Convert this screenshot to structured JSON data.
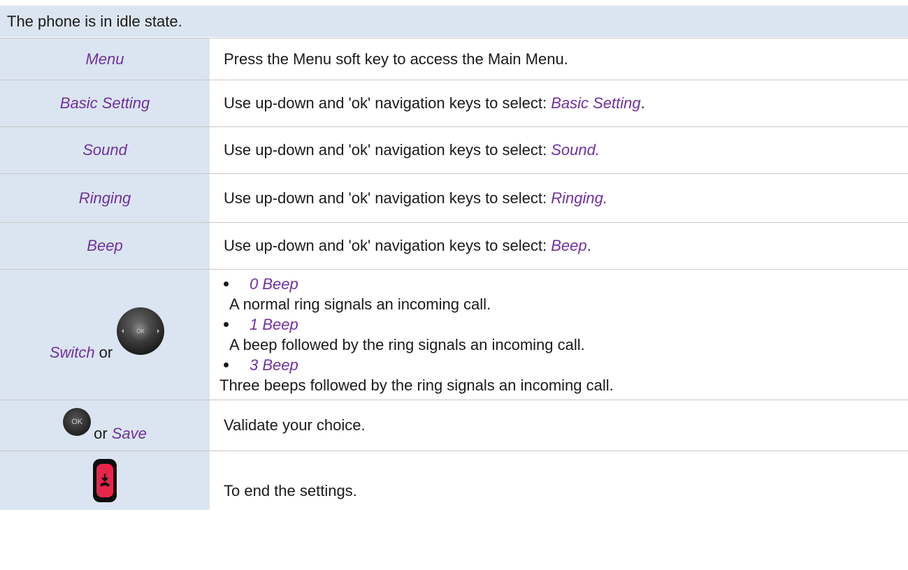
{
  "intro": "The phone is in idle state.",
  "rows": [
    {
      "key": "Menu",
      "desc": "Press the Menu soft key to access the Main Menu."
    },
    {
      "key": "Basic Setting",
      "desc_prefix": "Use up-down and 'ok' navigation keys to select: ",
      "desc_kw": "Basic Setting",
      "desc_suffix": "."
    },
    {
      "key": "Sound",
      "desc_prefix": "Use up-down and 'ok' navigation keys to select: ",
      "desc_kw": "Sound."
    },
    {
      "key": "Ringing",
      "desc_prefix": "Use up-down and 'ok' navigation keys to select: ",
      "desc_kw": "Ringing."
    },
    {
      "key": "Beep",
      "desc_prefix": "Use up-down and 'ok' navigation keys to select: ",
      "desc_kw": "Beep",
      "desc_suffix": "."
    }
  ],
  "switch_row": {
    "key": "Switch",
    "or": "or",
    "options": [
      {
        "name": "0 Beep",
        "desc": "A normal ring signals an incoming call."
      },
      {
        "name": "1 Beep",
        "desc": "A beep followed by the ring signals an incoming call."
      },
      {
        "name": "3 Beep",
        "desc": "Three beeps followed by the ring signals an incoming call."
      }
    ],
    "icon": "navigation-ok-key-icon"
  },
  "save_row": {
    "ok_label": "OK",
    "or": "or",
    "key": "Save",
    "desc": "Validate your choice.",
    "icon": "ok-key-icon"
  },
  "end_row": {
    "desc": "To end the settings.",
    "icon": "hang-up-key-icon"
  },
  "colors": {
    "accent": "#7030a0",
    "label_bg": "#dbe5f1",
    "end_key": "#e8264a"
  }
}
